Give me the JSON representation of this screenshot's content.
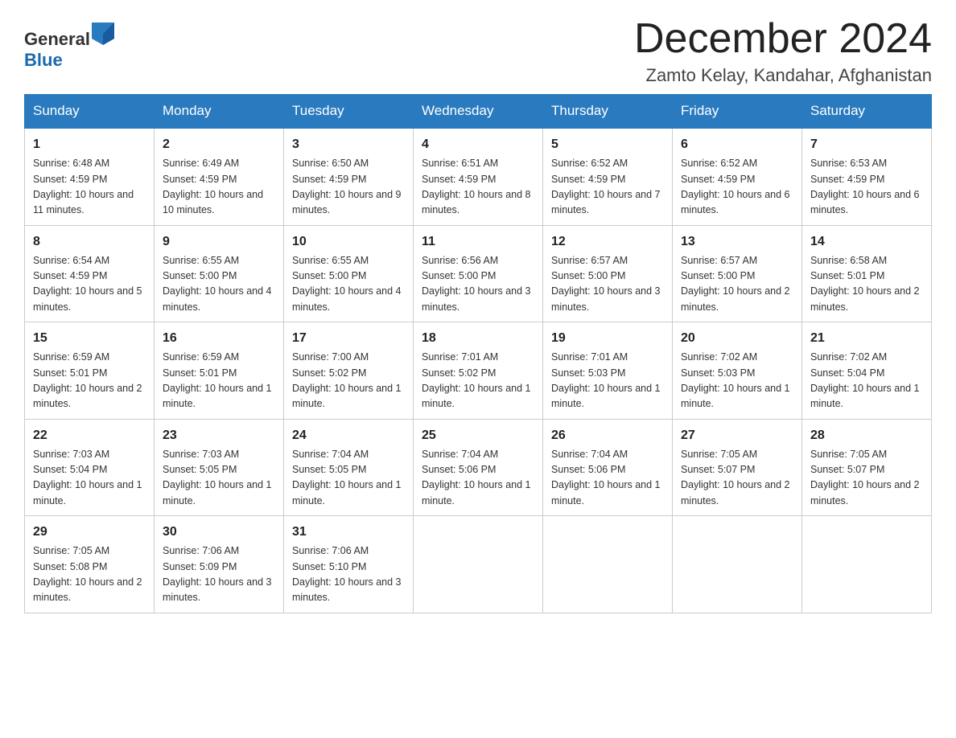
{
  "header": {
    "logo_general": "General",
    "logo_blue": "Blue",
    "month_year": "December 2024",
    "location": "Zamto Kelay, Kandahar, Afghanistan"
  },
  "days_of_week": [
    "Sunday",
    "Monday",
    "Tuesday",
    "Wednesday",
    "Thursday",
    "Friday",
    "Saturday"
  ],
  "weeks": [
    [
      {
        "day": "1",
        "sunrise": "6:48 AM",
        "sunset": "4:59 PM",
        "daylight": "10 hours and 11 minutes."
      },
      {
        "day": "2",
        "sunrise": "6:49 AM",
        "sunset": "4:59 PM",
        "daylight": "10 hours and 10 minutes."
      },
      {
        "day": "3",
        "sunrise": "6:50 AM",
        "sunset": "4:59 PM",
        "daylight": "10 hours and 9 minutes."
      },
      {
        "day": "4",
        "sunrise": "6:51 AM",
        "sunset": "4:59 PM",
        "daylight": "10 hours and 8 minutes."
      },
      {
        "day": "5",
        "sunrise": "6:52 AM",
        "sunset": "4:59 PM",
        "daylight": "10 hours and 7 minutes."
      },
      {
        "day": "6",
        "sunrise": "6:52 AM",
        "sunset": "4:59 PM",
        "daylight": "10 hours and 6 minutes."
      },
      {
        "day": "7",
        "sunrise": "6:53 AM",
        "sunset": "4:59 PM",
        "daylight": "10 hours and 6 minutes."
      }
    ],
    [
      {
        "day": "8",
        "sunrise": "6:54 AM",
        "sunset": "4:59 PM",
        "daylight": "10 hours and 5 minutes."
      },
      {
        "day": "9",
        "sunrise": "6:55 AM",
        "sunset": "5:00 PM",
        "daylight": "10 hours and 4 minutes."
      },
      {
        "day": "10",
        "sunrise": "6:55 AM",
        "sunset": "5:00 PM",
        "daylight": "10 hours and 4 minutes."
      },
      {
        "day": "11",
        "sunrise": "6:56 AM",
        "sunset": "5:00 PM",
        "daylight": "10 hours and 3 minutes."
      },
      {
        "day": "12",
        "sunrise": "6:57 AM",
        "sunset": "5:00 PM",
        "daylight": "10 hours and 3 minutes."
      },
      {
        "day": "13",
        "sunrise": "6:57 AM",
        "sunset": "5:00 PM",
        "daylight": "10 hours and 2 minutes."
      },
      {
        "day": "14",
        "sunrise": "6:58 AM",
        "sunset": "5:01 PM",
        "daylight": "10 hours and 2 minutes."
      }
    ],
    [
      {
        "day": "15",
        "sunrise": "6:59 AM",
        "sunset": "5:01 PM",
        "daylight": "10 hours and 2 minutes."
      },
      {
        "day": "16",
        "sunrise": "6:59 AM",
        "sunset": "5:01 PM",
        "daylight": "10 hours and 1 minute."
      },
      {
        "day": "17",
        "sunrise": "7:00 AM",
        "sunset": "5:02 PM",
        "daylight": "10 hours and 1 minute."
      },
      {
        "day": "18",
        "sunrise": "7:01 AM",
        "sunset": "5:02 PM",
        "daylight": "10 hours and 1 minute."
      },
      {
        "day": "19",
        "sunrise": "7:01 AM",
        "sunset": "5:03 PM",
        "daylight": "10 hours and 1 minute."
      },
      {
        "day": "20",
        "sunrise": "7:02 AM",
        "sunset": "5:03 PM",
        "daylight": "10 hours and 1 minute."
      },
      {
        "day": "21",
        "sunrise": "7:02 AM",
        "sunset": "5:04 PM",
        "daylight": "10 hours and 1 minute."
      }
    ],
    [
      {
        "day": "22",
        "sunrise": "7:03 AM",
        "sunset": "5:04 PM",
        "daylight": "10 hours and 1 minute."
      },
      {
        "day": "23",
        "sunrise": "7:03 AM",
        "sunset": "5:05 PM",
        "daylight": "10 hours and 1 minute."
      },
      {
        "day": "24",
        "sunrise": "7:04 AM",
        "sunset": "5:05 PM",
        "daylight": "10 hours and 1 minute."
      },
      {
        "day": "25",
        "sunrise": "7:04 AM",
        "sunset": "5:06 PM",
        "daylight": "10 hours and 1 minute."
      },
      {
        "day": "26",
        "sunrise": "7:04 AM",
        "sunset": "5:06 PM",
        "daylight": "10 hours and 1 minute."
      },
      {
        "day": "27",
        "sunrise": "7:05 AM",
        "sunset": "5:07 PM",
        "daylight": "10 hours and 2 minutes."
      },
      {
        "day": "28",
        "sunrise": "7:05 AM",
        "sunset": "5:07 PM",
        "daylight": "10 hours and 2 minutes."
      }
    ],
    [
      {
        "day": "29",
        "sunrise": "7:05 AM",
        "sunset": "5:08 PM",
        "daylight": "10 hours and 2 minutes."
      },
      {
        "day": "30",
        "sunrise": "7:06 AM",
        "sunset": "5:09 PM",
        "daylight": "10 hours and 3 minutes."
      },
      {
        "day": "31",
        "sunrise": "7:06 AM",
        "sunset": "5:10 PM",
        "daylight": "10 hours and 3 minutes."
      },
      null,
      null,
      null,
      null
    ]
  ]
}
